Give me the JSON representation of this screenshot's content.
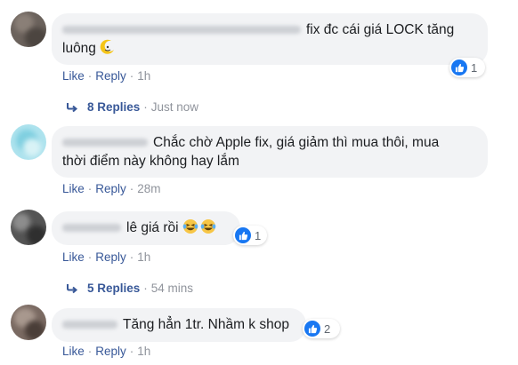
{
  "colors": {
    "link": "#385898",
    "muted": "#90949c",
    "bubble": "#f2f3f5",
    "like_blue": "#1877f2"
  },
  "comments": [
    {
      "text_line1": "fix đc cái giá LOCK tăng",
      "text_line2": "luông",
      "emoji_icon": "crescent-smile-emoji-icon",
      "reaction_count": "1",
      "like": "Like",
      "reply": "Reply",
      "time": "1h",
      "replies": {
        "label": "8 Replies",
        "time": "Just now"
      }
    },
    {
      "text_line1": "Chắc chờ Apple fix, giá giảm thì mua thôi, mua",
      "text_line2": "thời điểm này không hay lắm",
      "like": "Like",
      "reply": "Reply",
      "time": "28m"
    },
    {
      "text_line1": "lê giá rồi",
      "emoji_icon": "laughing-tears-emoji-icon",
      "reaction_count": "1",
      "like": "Like",
      "reply": "Reply",
      "time": "1h",
      "replies": {
        "label": "5 Replies",
        "time": "54 mins"
      }
    },
    {
      "text_line1": "Tăng hẳn 1tr. Nhầm k shop",
      "reaction_count": "2",
      "like": "Like",
      "reply": "Reply",
      "time": "1h"
    }
  ],
  "separator": "·"
}
